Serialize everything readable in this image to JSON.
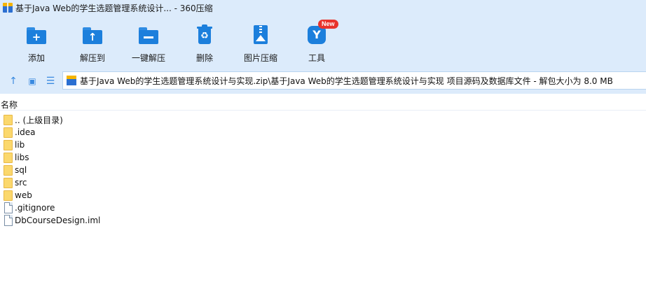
{
  "window": {
    "title": "基于Java Web的学生选题管理系统设计... - 360压缩"
  },
  "toolbar": {
    "buttons": [
      {
        "label": "添加",
        "icon": "add-folder-icon"
      },
      {
        "label": "解压到",
        "icon": "extract-to-icon"
      },
      {
        "label": "一键解压",
        "icon": "one-click-extract-icon"
      },
      {
        "label": "删除",
        "icon": "delete-icon"
      },
      {
        "label": "图片压缩",
        "icon": "image-compress-icon"
      },
      {
        "label": "工具",
        "icon": "tools-icon",
        "badge": "New"
      }
    ]
  },
  "address": {
    "path": "基于Java Web的学生选题管理系统设计与实现.zip\\基于Java Web的学生选题管理系统设计与实现 项目源码及数据库文件 - 解包大小为 8.0 MB"
  },
  "list": {
    "column_name": "名称",
    "items": [
      {
        "name": ".. (上级目录)",
        "type": "folder"
      },
      {
        "name": ".idea",
        "type": "folder"
      },
      {
        "name": "lib",
        "type": "folder"
      },
      {
        "name": "libs",
        "type": "folder"
      },
      {
        "name": "sql",
        "type": "folder"
      },
      {
        "name": "src",
        "type": "folder"
      },
      {
        "name": "web",
        "type": "folder"
      },
      {
        "name": ".gitignore",
        "type": "file"
      },
      {
        "name": "DbCourseDesign.iml",
        "type": "file"
      }
    ]
  },
  "colors": {
    "toolbar_bg": "#dcebfb",
    "accent": "#1c7fdc",
    "badge": "#e8332b",
    "folder": "#fbd86d"
  }
}
